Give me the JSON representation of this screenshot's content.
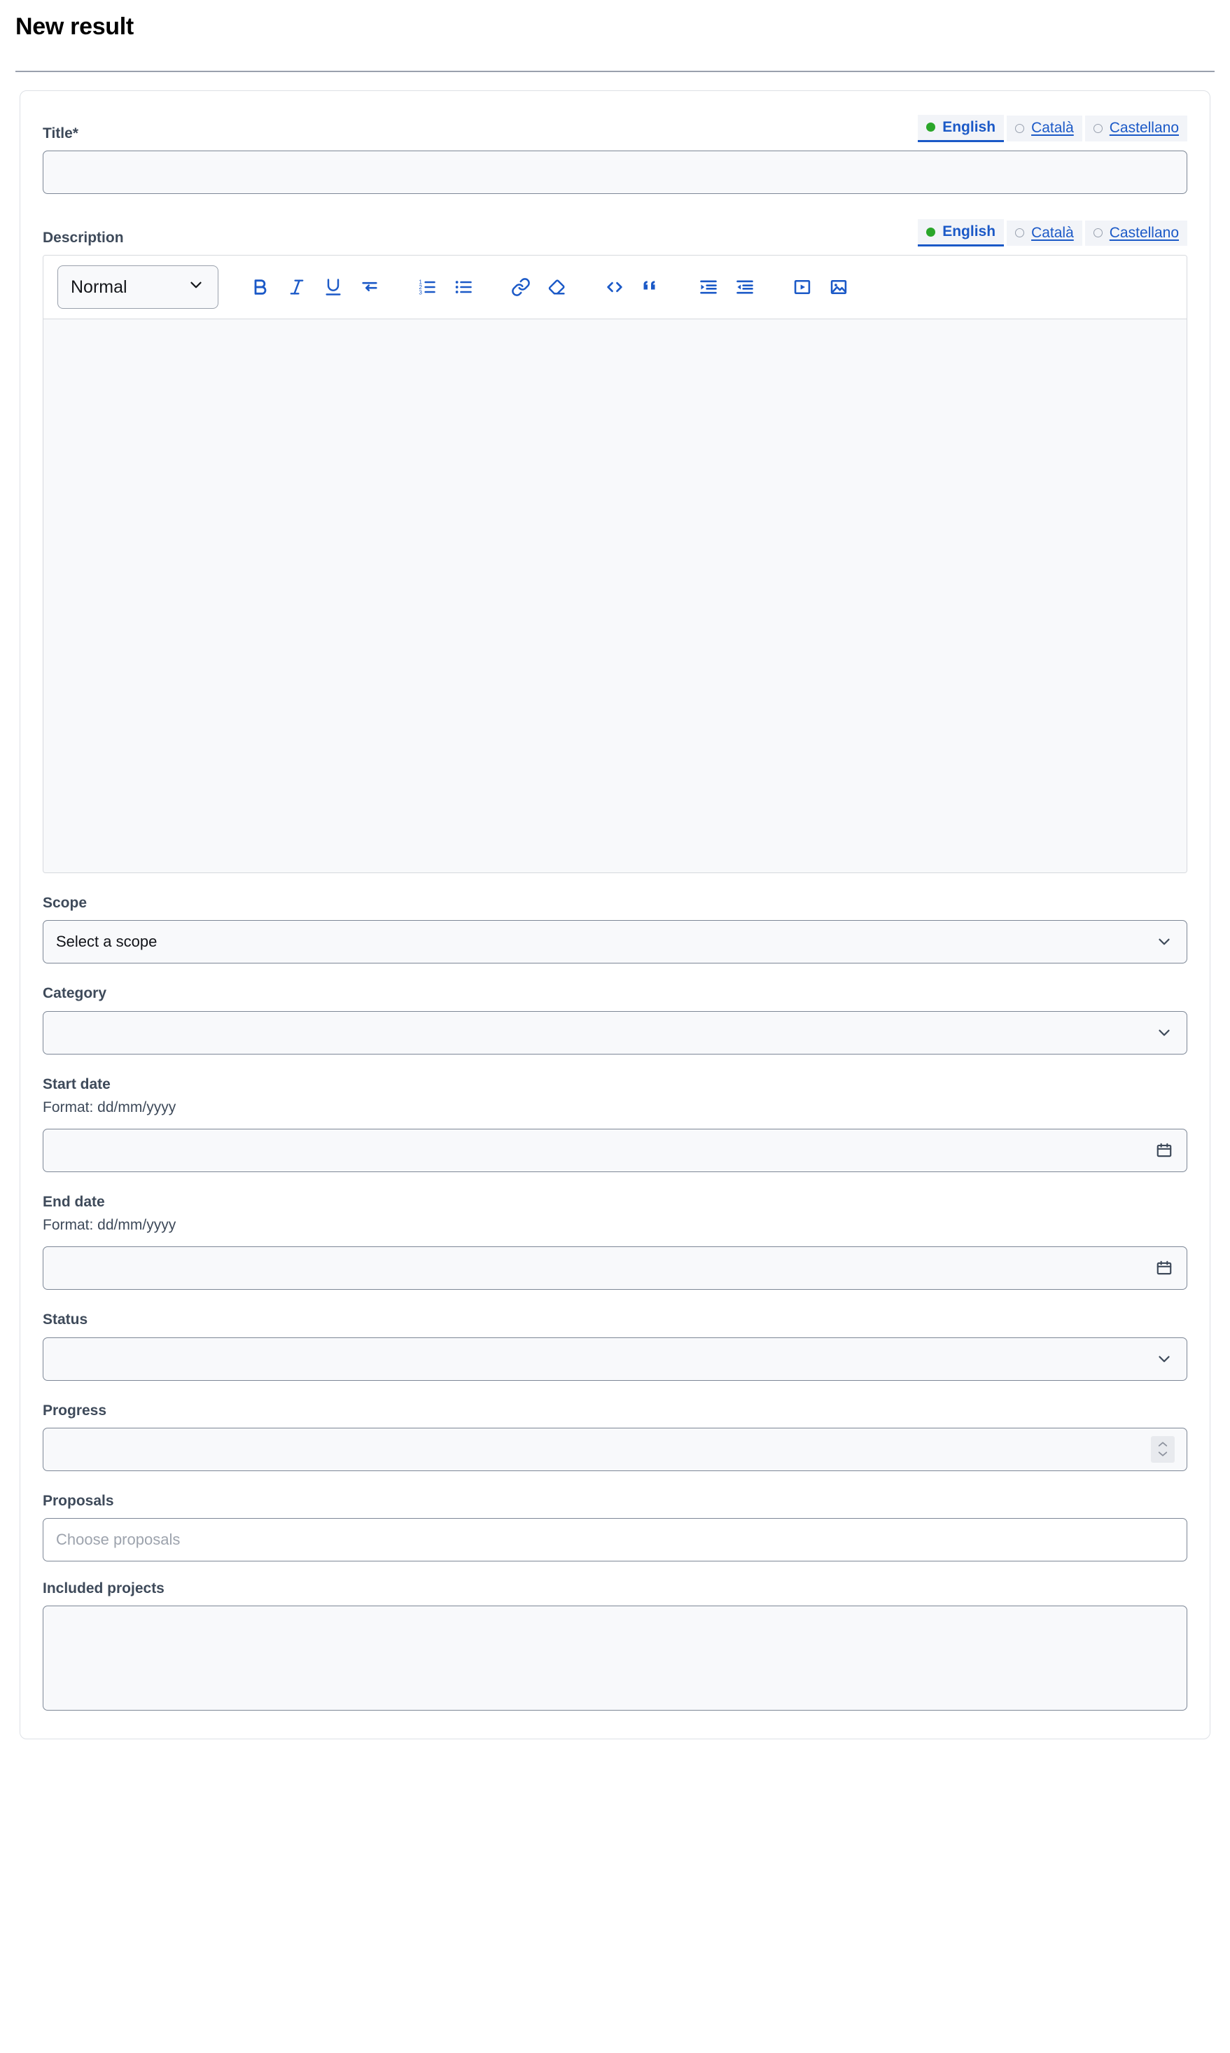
{
  "page": {
    "title": "New result"
  },
  "languages": [
    {
      "label": "English",
      "active": true
    },
    {
      "label": "Català",
      "active": false
    },
    {
      "label": "Castellano",
      "active": false
    }
  ],
  "form": {
    "title": {
      "label": "Title*",
      "value": "",
      "placeholder": ""
    },
    "description": {
      "label": "Description",
      "value": ""
    },
    "editor": {
      "format_label": "Normal",
      "tools": [
        {
          "name": "bold-icon",
          "title": "Bold"
        },
        {
          "name": "italic-icon",
          "title": "Italic"
        },
        {
          "name": "underline-icon",
          "title": "Underline"
        },
        {
          "name": "line-break-icon",
          "title": "Line break"
        },
        {
          "name": "ordered-list-icon",
          "title": "Ordered list"
        },
        {
          "name": "unordered-list-icon",
          "title": "Unordered list"
        },
        {
          "name": "link-icon",
          "title": "Link"
        },
        {
          "name": "erase-format-icon",
          "title": "Erase styles"
        },
        {
          "name": "code-icon",
          "title": "Code"
        },
        {
          "name": "blockquote-icon",
          "title": "Blockquote"
        },
        {
          "name": "indent-increase-icon",
          "title": "Indent"
        },
        {
          "name": "indent-decrease-icon",
          "title": "Outdent"
        },
        {
          "name": "video-icon",
          "title": "Video"
        },
        {
          "name": "image-icon",
          "title": "Image"
        }
      ]
    },
    "scope": {
      "label": "Scope",
      "value": "Select a scope"
    },
    "category": {
      "label": "Category",
      "value": ""
    },
    "start_date": {
      "label": "Start date",
      "hint": "Format: dd/mm/yyyy",
      "value": ""
    },
    "end_date": {
      "label": "End date",
      "hint": "Format: dd/mm/yyyy",
      "value": ""
    },
    "status": {
      "label": "Status",
      "value": ""
    },
    "progress": {
      "label": "Progress",
      "value": ""
    },
    "proposals": {
      "label": "Proposals",
      "value": "",
      "placeholder": "Choose proposals"
    },
    "included_projects": {
      "label": "Included projects",
      "value": ""
    }
  },
  "colors": {
    "accent": "#1b59c7",
    "active_dot": "#2aa62a",
    "label": "#3e4a5a",
    "border": "#7d8796",
    "field_bg": "#f8f9fb"
  }
}
